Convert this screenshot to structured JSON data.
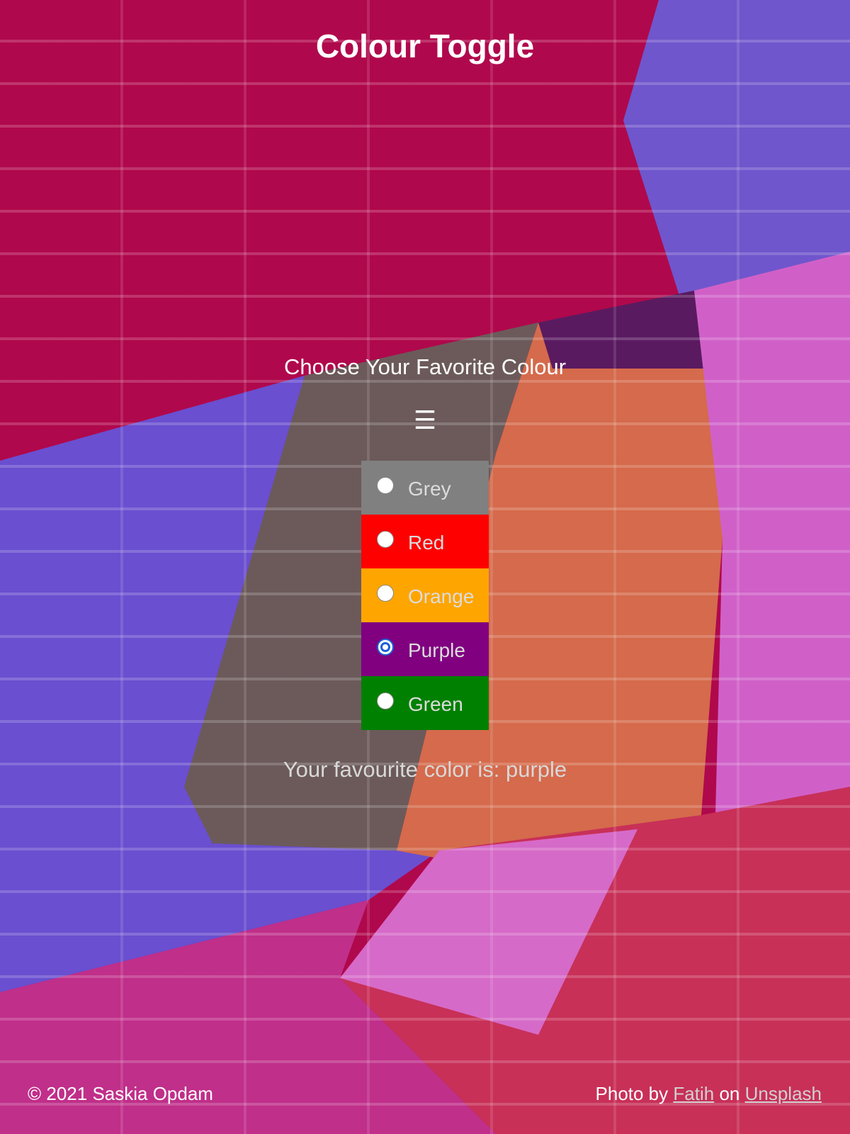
{
  "page": {
    "title": "Colour Toggle"
  },
  "picker": {
    "label": "Choose Your Favorite Colour",
    "menu_icon": "☰",
    "options": [
      {
        "label": "Grey",
        "color": "#808080",
        "checked": false
      },
      {
        "label": "Red",
        "color": "#ff0000",
        "checked": false
      },
      {
        "label": "Orange",
        "color": "#ffa500",
        "checked": false
      },
      {
        "label": "Purple",
        "color": "#800080",
        "checked": true
      },
      {
        "label": "Green",
        "color": "#008000",
        "checked": false
      }
    ],
    "result_text": "Your favourite color is: purple"
  },
  "footer": {
    "copyright": "© 2021 Saskia Opdam",
    "credit_prefix": "Photo by",
    "credit_author": "Fatih",
    "credit_middle": "on",
    "credit_site": "Unsplash"
  },
  "colors": {
    "background_red": "#b0084c",
    "background_blue": "#6a4fd0",
    "background_orange": "#d66a4a",
    "background_pink": "#d060c8",
    "background_grey": "#6a5a5a",
    "text": "#ffffff",
    "radio_checked": "#1a5fd6"
  }
}
